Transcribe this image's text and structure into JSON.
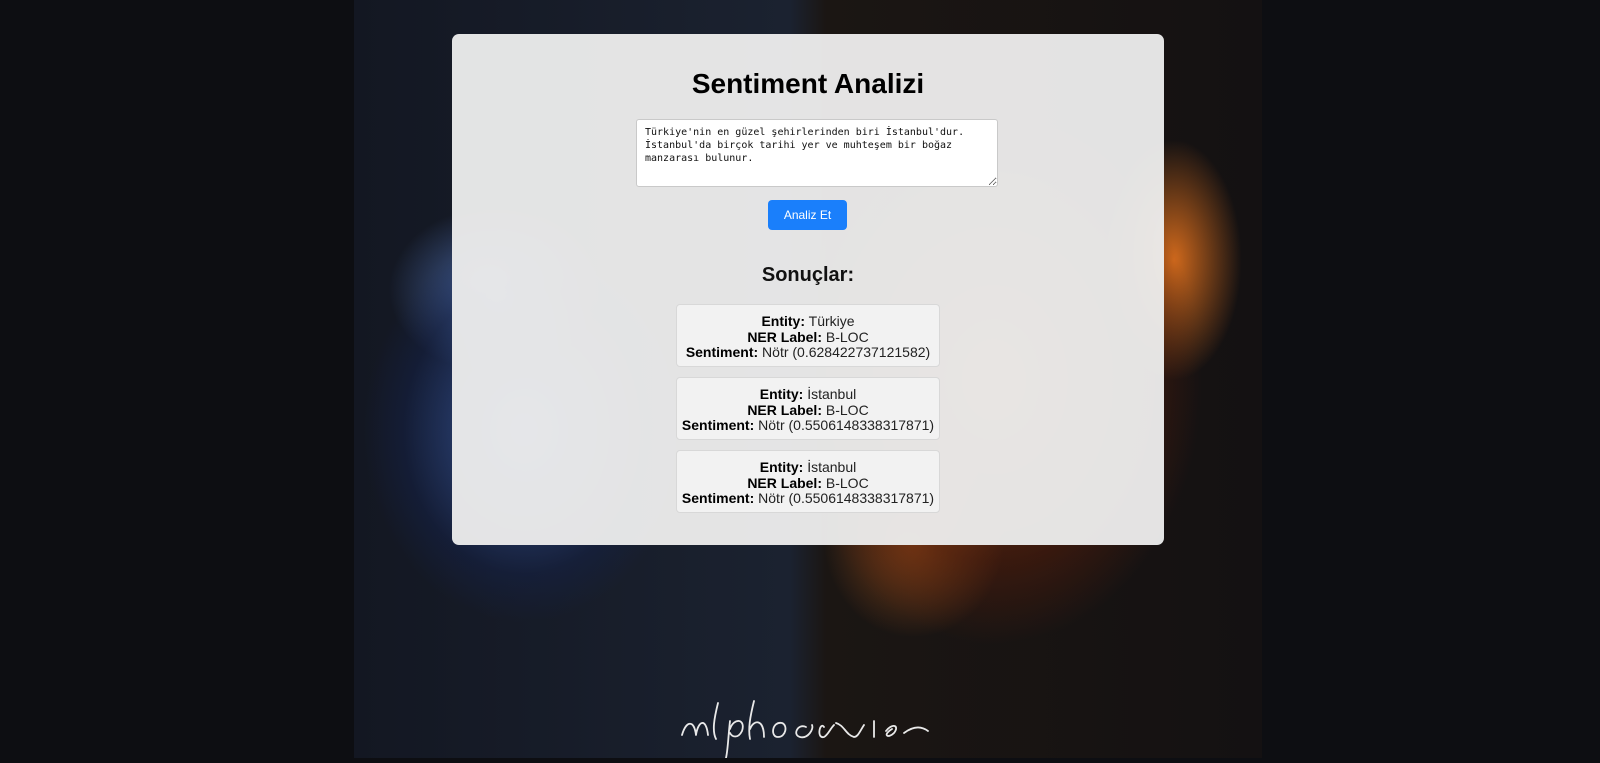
{
  "page": {
    "title": "Sentiment Analizi",
    "input_text": "Türkiye'nin en güzel şehirlerinden biri İstanbul'dur. İstanbul'da birçok tarihi yer ve muhteşem bir boğaz manzarası bulunur.",
    "analyze_button": "Analiz Et",
    "results_title": "Sonuçlar:",
    "labels": {
      "entity": "Entity:",
      "ner": "NER Label:",
      "sentiment": "Sentiment:"
    }
  },
  "results": [
    {
      "entity": "Türkiye",
      "ner_label": "B-LOC",
      "sentiment": "Nötr (0.628422737121582)"
    },
    {
      "entity": "İstanbul",
      "ner_label": "B-LOC",
      "sentiment": "Nötr (0.5506148338317871)"
    },
    {
      "entity": "İstanbul",
      "ner_label": "B-LOC",
      "sentiment": "Nötr (0.5506148338317871)"
    }
  ],
  "background": {
    "signature": "nlphoenise",
    "colors": {
      "page": "#0d0e12",
      "card": "#ececec",
      "button": "#1a7ffb"
    }
  }
}
